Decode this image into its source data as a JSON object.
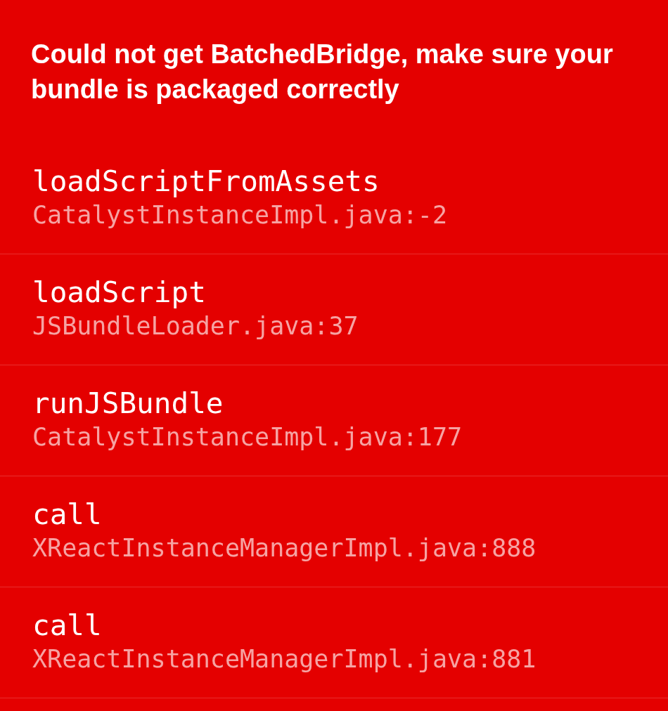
{
  "title": "Could not get BatchedBridge, make sure your bundle is packaged correctly",
  "frames": [
    {
      "method": "loadScriptFromAssets",
      "location": "CatalystInstanceImpl.java:-2"
    },
    {
      "method": "loadScript",
      "location": "JSBundleLoader.java:37"
    },
    {
      "method": "runJSBundle",
      "location": "CatalystInstanceImpl.java:177"
    },
    {
      "method": "call",
      "location": "XReactInstanceManagerImpl.java:888"
    },
    {
      "method": "call",
      "location": "XReactInstanceManagerImpl.java:881"
    }
  ]
}
